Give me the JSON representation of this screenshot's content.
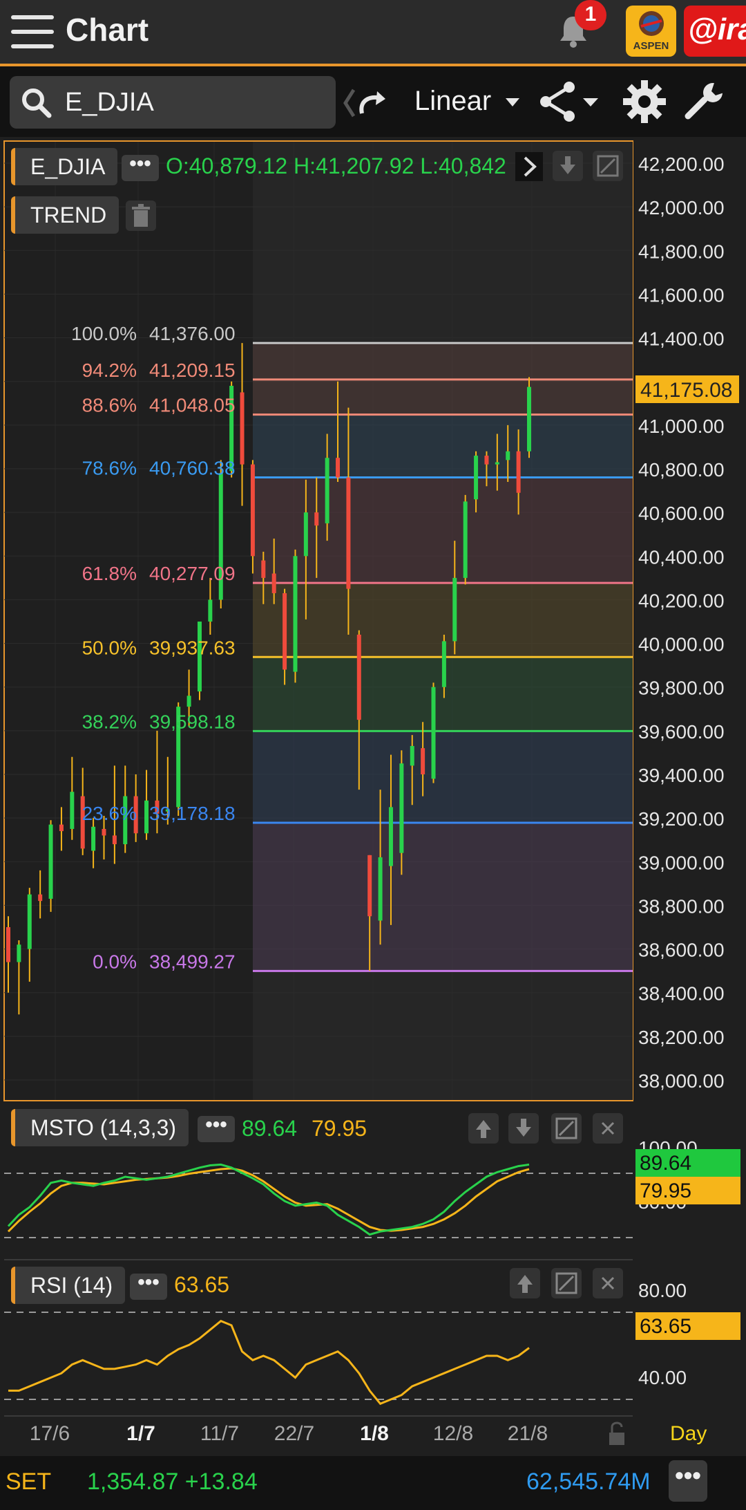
{
  "header": {
    "title": "Chart",
    "notification_count": "1",
    "aspen_label": "ASPEN",
    "ira_label": "@ira"
  },
  "toolbar": {
    "symbol": "E_DJIA",
    "scale": "Linear"
  },
  "main_chart": {
    "symbol_label": "E_DJIA",
    "indicator_label": "TREND",
    "ohlc_text": "O:40,879.12  H:41,207.92  L:40,842",
    "current_price": "41,175.08",
    "y_ticks": [
      "42,200.00",
      "42,000.00",
      "41,800.00",
      "41,600.00",
      "41,400.00",
      "41,200.00",
      "41,000.00",
      "40,800.00",
      "40,600.00",
      "40,400.00",
      "40,200.00",
      "40,000.00",
      "39,800.00",
      "39,600.00",
      "39,400.00",
      "39,200.00",
      "39,000.00",
      "38,800.00",
      "38,600.00",
      "38,400.00",
      "38,200.00",
      "38,000.00"
    ],
    "fib_levels": [
      {
        "pct": "100.0%",
        "price": "41,376.00",
        "value": 41376.0,
        "color": "#c8c8c8"
      },
      {
        "pct": "94.2%",
        "price": "41,209.15",
        "value": 41209.15,
        "color": "#f08a78"
      },
      {
        "pct": "88.6%",
        "price": "41,048.05",
        "value": 41048.05,
        "color": "#f08a78"
      },
      {
        "pct": "78.6%",
        "price": "40,760.38",
        "value": 40760.38,
        "color": "#3a9af0"
      },
      {
        "pct": "61.8%",
        "price": "40,277.09",
        "value": 40277.09,
        "color": "#f07488"
      },
      {
        "pct": "50.0%",
        "price": "39,937.63",
        "value": 39937.63,
        "color": "#f6c12a"
      },
      {
        "pct": "38.2%",
        "price": "39,598.18",
        "value": 39598.18,
        "color": "#34d25a"
      },
      {
        "pct": "23.6%",
        "price": "39,178.18",
        "value": 39178.18,
        "color": "#3a86f0"
      },
      {
        "pct": "0.0%",
        "price": "38,499.27",
        "value": 38499.27,
        "color": "#c878e8"
      }
    ]
  },
  "msto": {
    "label": "MSTO (14,3,3)",
    "k_value": "89.64",
    "d_value": "79.95",
    "tick_top": "100.00",
    "tick_bottom": "80.00"
  },
  "rsi": {
    "label": "RSI (14)",
    "value": "63.65",
    "ticks": [
      "80.00",
      "40.00"
    ]
  },
  "x_axis": {
    "labels": [
      "17/6",
      "1/7",
      "11/7",
      "22/7",
      "1/8",
      "12/8",
      "21/8"
    ],
    "interval": "Day"
  },
  "footer": {
    "index_name": "SET",
    "index_value": "1,354.87 +13.84",
    "volume": "62,545.74M"
  },
  "colors": {
    "accent": "#e8962c",
    "up": "#29d24c",
    "down": "#ef4b3c",
    "signal": "#f6b51a"
  },
  "chart_data": {
    "type": "candlestick",
    "y_range": [
      37900,
      42300
    ],
    "candles": [
      {
        "o": 38700,
        "h": 38750,
        "l": 38400,
        "c": 38540
      },
      {
        "o": 38540,
        "h": 38640,
        "l": 38300,
        "c": 38620
      },
      {
        "o": 38600,
        "h": 38880,
        "l": 38450,
        "c": 38850
      },
      {
        "o": 38850,
        "h": 38960,
        "l": 38740,
        "c": 38820
      },
      {
        "o": 38830,
        "h": 39190,
        "l": 38770,
        "c": 39170
      },
      {
        "o": 39170,
        "h": 39250,
        "l": 39050,
        "c": 39140
      },
      {
        "o": 39150,
        "h": 39480,
        "l": 39100,
        "c": 39320
      },
      {
        "o": 39300,
        "h": 39430,
        "l": 39030,
        "c": 39060
      },
      {
        "o": 39050,
        "h": 39200,
        "l": 38970,
        "c": 39160
      },
      {
        "o": 39150,
        "h": 39210,
        "l": 39010,
        "c": 39120
      },
      {
        "o": 39120,
        "h": 39440,
        "l": 38990,
        "c": 39080
      },
      {
        "o": 39080,
        "h": 39440,
        "l": 39040,
        "c": 39300
      },
      {
        "o": 39300,
        "h": 39400,
        "l": 39090,
        "c": 39130
      },
      {
        "o": 39130,
        "h": 39420,
        "l": 39100,
        "c": 39280
      },
      {
        "o": 39280,
        "h": 39600,
        "l": 39130,
        "c": 39220
      },
      {
        "o": 39230,
        "h": 39480,
        "l": 39170,
        "c": 39240
      },
      {
        "o": 39250,
        "h": 39730,
        "l": 39210,
        "c": 39710
      },
      {
        "o": 39710,
        "h": 39880,
        "l": 39620,
        "c": 39760
      },
      {
        "o": 39780,
        "h": 40100,
        "l": 39740,
        "c": 40100
      },
      {
        "o": 40100,
        "h": 40300,
        "l": 40040,
        "c": 40200
      },
      {
        "o": 40200,
        "h": 40840,
        "l": 40160,
        "c": 40780
      },
      {
        "o": 40790,
        "h": 41200,
        "l": 40760,
        "c": 41180
      },
      {
        "o": 41150,
        "h": 41376,
        "l": 40630,
        "c": 40820
      },
      {
        "o": 40820,
        "h": 40840,
        "l": 40320,
        "c": 40400
      },
      {
        "o": 40380,
        "h": 40420,
        "l": 40180,
        "c": 40300
      },
      {
        "o": 40320,
        "h": 40480,
        "l": 40180,
        "c": 40230
      },
      {
        "o": 40230,
        "h": 40250,
        "l": 39810,
        "c": 39880
      },
      {
        "o": 39870,
        "h": 40430,
        "l": 39820,
        "c": 40400
      },
      {
        "o": 40400,
        "h": 40750,
        "l": 40110,
        "c": 40600
      },
      {
        "o": 40600,
        "h": 40760,
        "l": 40300,
        "c": 40540
      },
      {
        "o": 40550,
        "h": 40960,
        "l": 40470,
        "c": 40850
      },
      {
        "o": 40850,
        "h": 41200,
        "l": 40740,
        "c": 40760
      },
      {
        "o": 40760,
        "h": 41080,
        "l": 40040,
        "c": 40250
      },
      {
        "o": 40040,
        "h": 40060,
        "l": 39330,
        "c": 39650
      },
      {
        "o": 39030,
        "h": 39030,
        "l": 38500,
        "c": 38750
      },
      {
        "o": 38730,
        "h": 39330,
        "l": 38620,
        "c": 39020
      },
      {
        "o": 38980,
        "h": 39490,
        "l": 38710,
        "c": 39250
      },
      {
        "o": 39040,
        "h": 39510,
        "l": 38940,
        "c": 39450
      },
      {
        "o": 39440,
        "h": 39580,
        "l": 39260,
        "c": 39530
      },
      {
        "o": 39520,
        "h": 39640,
        "l": 39300,
        "c": 39400
      },
      {
        "o": 39380,
        "h": 39820,
        "l": 39360,
        "c": 39800
      },
      {
        "o": 39800,
        "h": 40040,
        "l": 39750,
        "c": 40010
      },
      {
        "o": 40010,
        "h": 40470,
        "l": 39950,
        "c": 40300
      },
      {
        "o": 40300,
        "h": 40680,
        "l": 40270,
        "c": 40650
      },
      {
        "o": 40660,
        "h": 40880,
        "l": 40600,
        "c": 40860
      },
      {
        "o": 40860,
        "h": 40880,
        "l": 40720,
        "c": 40820
      },
      {
        "o": 40820,
        "h": 40960,
        "l": 40700,
        "c": 40830
      },
      {
        "o": 40840,
        "h": 41000,
        "l": 40740,
        "c": 40880
      },
      {
        "o": 40880,
        "h": 40980,
        "l": 40590,
        "c": 40690
      },
      {
        "o": 40880,
        "h": 41220,
        "l": 40850,
        "c": 41175
      }
    ],
    "msto": {
      "k": [
        15,
        30,
        40,
        55,
        72,
        75,
        72,
        70,
        68,
        72,
        75,
        80,
        78,
        76,
        78,
        80,
        84,
        88,
        92,
        95,
        96,
        92,
        85,
        78,
        70,
        58,
        48,
        42,
        44,
        46,
        42,
        30,
        22,
        14,
        4,
        8,
        10,
        12,
        14,
        18,
        24,
        34,
        48,
        60,
        70,
        80,
        86,
        90,
        94,
        96
      ],
      "d": [
        8,
        22,
        34,
        45,
        58,
        68,
        72,
        72,
        71,
        70,
        72,
        74,
        76,
        77,
        78,
        79,
        81,
        84,
        86,
        88,
        90,
        91,
        88,
        82,
        74,
        64,
        54,
        46,
        42,
        43,
        44,
        38,
        30,
        22,
        14,
        10,
        9,
        10,
        12,
        14,
        18,
        24,
        32,
        42,
        54,
        64,
        74,
        80,
        86,
        90
      ]
    },
    "rsi": [
      44,
      44,
      46,
      48,
      50,
      52,
      56,
      58,
      56,
      54,
      54,
      55,
      56,
      58,
      56,
      60,
      63,
      65,
      68,
      72,
      76,
      74,
      62,
      58,
      60,
      58,
      54,
      50,
      56,
      58,
      60,
      62,
      58,
      52,
      44,
      38,
      40,
      42,
      46,
      48,
      50,
      52,
      54,
      56,
      58,
      60,
      60,
      58,
      60,
      63.65
    ]
  }
}
